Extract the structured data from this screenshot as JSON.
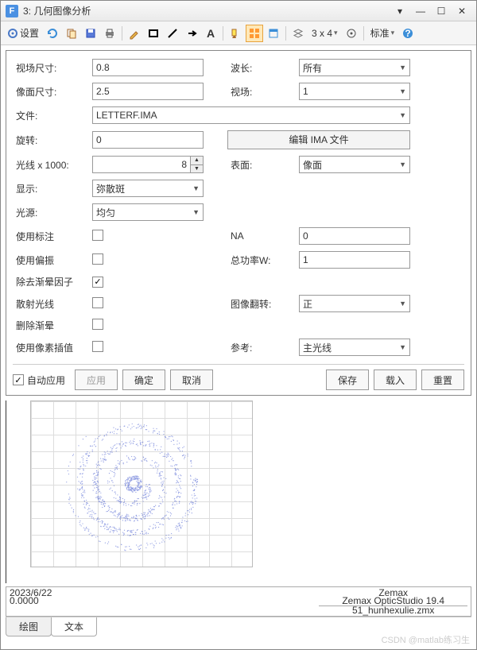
{
  "window": {
    "icon": "F",
    "title": "3: 几何图像分析"
  },
  "toolbar": {
    "settings": "设置",
    "grid_label": "3 x 4",
    "std": "标准"
  },
  "form": {
    "field_size_lbl": "视场尺寸:",
    "field_size": "0.8",
    "image_size_lbl": "像面尺寸:",
    "image_size": "2.5",
    "file_lbl": "文件:",
    "file": "LETTERF.IMA",
    "rotate_lbl": "旋转:",
    "rotate": "0",
    "rays_lbl": "光线 x 1000:",
    "rays": "8",
    "display_lbl": "显示:",
    "display": "弥散斑",
    "source_lbl": "光源:",
    "source": "均匀",
    "use_label_lbl": "使用标注",
    "use_polar_lbl": "使用偏振",
    "remove_vig_lbl": "除去渐晕因子",
    "scatter_lbl": "散射光线",
    "delete_vig_lbl": "删除渐晕",
    "pixel_interp_lbl": "使用像素插值",
    "wavelength_lbl": "波长:",
    "wavelength": "所有",
    "field_lbl": "视场:",
    "field": "1",
    "edit_btn": "编辑 IMA 文件",
    "surface_lbl": "表面:",
    "surface": "像面",
    "na_lbl": "NA",
    "na": "0",
    "power_lbl": "总功率W:",
    "power": "1",
    "flip_lbl": "图像翻转:",
    "flip": "正",
    "ref_lbl": "参考:",
    "ref": "主光线"
  },
  "checks": {
    "use_label": false,
    "use_polar": false,
    "remove_vig": true,
    "scatter": false,
    "delete_vig": false,
    "pixel_interp": false
  },
  "footer": {
    "auto_apply": "自动应用",
    "apply": "应用",
    "ok": "确定",
    "cancel": "取消",
    "save": "保存",
    "load": "载入",
    "reset": "重置"
  },
  "tabs": {
    "plot": "绘图",
    "text": "文本"
  },
  "legend": {
    "date": "2023/6/22",
    "l2": "",
    "l3": "0.0000",
    "zemax": "Zemax",
    "studio": "Zemax OpticStudio 19.4",
    "file": "51_hunhexulie.zmx"
  },
  "watermark": "CSDN @matlab练习生"
}
